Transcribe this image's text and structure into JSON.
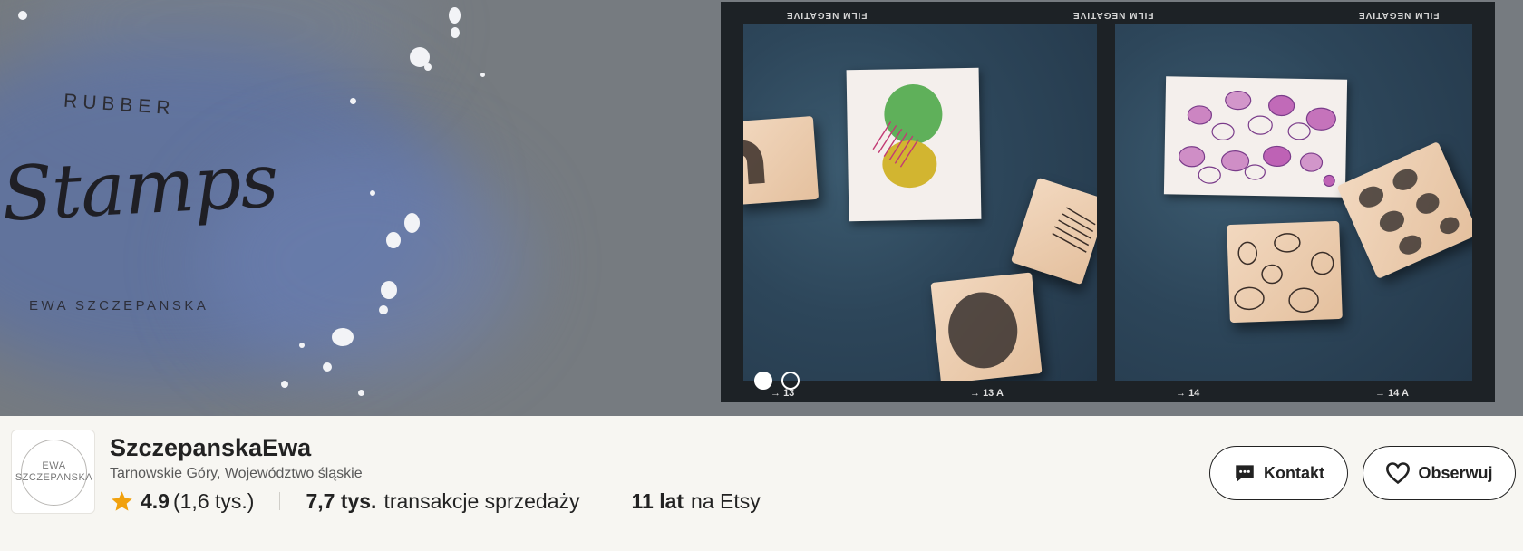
{
  "banner": {
    "brand_rubber": "RUBBER",
    "brand_stamps": "Stamps",
    "brand_name": "EWA SZCZEPANSKA",
    "film_top": "FILM NEGATIVE",
    "film_labels": [
      "13",
      "13 A",
      "14",
      "14 A"
    ],
    "slideshow": {
      "slides": 2,
      "active": 1
    }
  },
  "shop": {
    "avatar_line1": "EWA",
    "avatar_line2": "SZCZEPANSKA",
    "name": "SzczepanskaEwa",
    "location": "Tarnowskie Góry, Województwo śląskie",
    "rating": "4.9",
    "reviews": "(1,6 tys.)",
    "sales_count": "7,7 tys.",
    "sales_label": "transakcje sprzedaży",
    "years_count": "11 lat",
    "years_label": "na Etsy"
  },
  "actions": {
    "contact_label": "Kontakt",
    "follow_label": "Obserwuj"
  },
  "colors": {
    "star": "#f1a10d",
    "banner_bg": "#767b80",
    "page_bg": "#f7f6f2"
  }
}
